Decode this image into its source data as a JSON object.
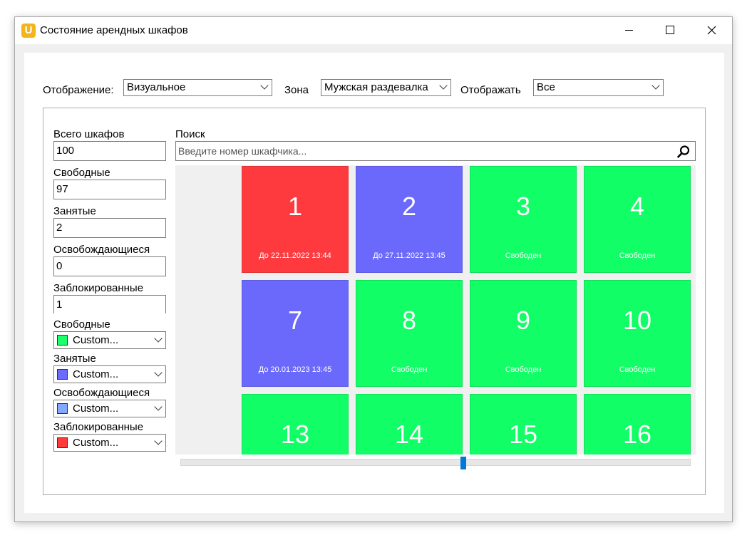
{
  "window": {
    "title": "Состояние арендных шкафов",
    "icon_letter": "U"
  },
  "toolbar": {
    "display_label": "Отображение:",
    "display_value": "Визуальное",
    "zone_label": "Зона",
    "zone_value": "Мужская раздевалка",
    "show_label": "Отображать",
    "show_value": "Все"
  },
  "stats": {
    "total_label": "Всего шкафов",
    "total_value": "100",
    "free_label": "Свободные",
    "free_value": "97",
    "busy_label": "Занятые",
    "busy_value": "2",
    "releasing_label": "Освобождающиеся",
    "releasing_value": "0",
    "blocked_label": "Заблокированные",
    "blocked_value": "1"
  },
  "colors": {
    "free": {
      "label": "Свободные",
      "value": "Custom...",
      "color": "#1aff6a"
    },
    "busy": {
      "label": "Занятые",
      "value": "Custom...",
      "color": "#6b6bff"
    },
    "releasing": {
      "label": "Освобождающиеся",
      "value": "Custom...",
      "color": "#84a8ff"
    },
    "blocked": {
      "label": "Заблокированные",
      "value": "Custom...",
      "color": "#ff3a3a"
    }
  },
  "search": {
    "label": "Поиск",
    "placeholder": "Введите номер шкафчика..."
  },
  "lockers": [
    {
      "number": "1",
      "status": "До 22.11.2022 13:44",
      "color": "#ff3a3f"
    },
    {
      "number": "2",
      "status": "До 27.11.2022 13:45",
      "color": "#6b68fc"
    },
    {
      "number": "3",
      "status": "Свободен",
      "color": "#12fe66"
    },
    {
      "number": "4",
      "status": "Свободен",
      "color": "#12fe66"
    },
    {
      "number": "7",
      "status": "До 20.01.2023 13:45",
      "color": "#6b68fc"
    },
    {
      "number": "8",
      "status": "Свободен",
      "color": "#12fe66"
    },
    {
      "number": "9",
      "status": "Свободен",
      "color": "#12fe66"
    },
    {
      "number": "10",
      "status": "Свободен",
      "color": "#12fe66"
    },
    {
      "number": "13",
      "status": "",
      "color": "#12fe66"
    },
    {
      "number": "14",
      "status": "",
      "color": "#12fe66"
    },
    {
      "number": "15",
      "status": "",
      "color": "#12fe66"
    },
    {
      "number": "16",
      "status": "",
      "color": "#12fe66"
    }
  ],
  "scrollbar": {
    "position": 0.55
  }
}
